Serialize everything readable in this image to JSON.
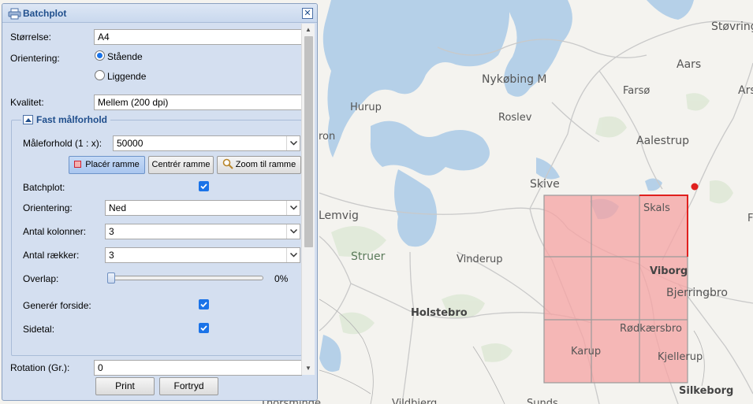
{
  "dialog": {
    "title": "Batchplot",
    "close_label": "✕"
  },
  "form": {
    "size_label": "Størrelse:",
    "size_value": "A4",
    "orientation_label": "Orientering:",
    "orientation_options": [
      "Stående",
      "Liggende"
    ],
    "orientation_selected": "Stående",
    "quality_label": "Kvalitet:",
    "quality_value": "Mellem (200 dpi)",
    "rotation_label": "Rotation (Gr.):",
    "rotation_value": "0"
  },
  "fixed_scale": {
    "legend": "Fast målforhold",
    "scale_label": "Måleforhold (1 : x):",
    "scale_value": "50000",
    "place_frame_label": "Placér ramme",
    "center_frame_label": "Centrér ramme",
    "zoom_frame_label": "Zoom til ramme",
    "batchplot_label": "Batchplot:",
    "batchplot_checked": true,
    "orientation_label": "Orientering:",
    "orientation_value": "Ned",
    "columns_label": "Antal kolonner:",
    "columns_value": "3",
    "rows_label": "Antal rækker:",
    "rows_value": "3",
    "overlap_label": "Overlap:",
    "overlap_value": "0%",
    "overlap_fraction": 0,
    "cover_label": "Generér forside:",
    "cover_checked": true,
    "page_numbers_label": "Sidetal:",
    "page_numbers_checked": true
  },
  "actions": {
    "print_label": "Print",
    "cancel_label": "Fortryd"
  },
  "map": {
    "places": [
      "Støvring",
      "Aars",
      "Ars",
      "Farsø",
      "Nykøbing M",
      "Hurup",
      "Roslev",
      "Aalestrup",
      "Skive",
      "Skals",
      "Lemvig",
      "Struer",
      "Vinderup",
      "Viborg",
      "Bjerringbro",
      "Holstebro",
      "Rødkærsbro",
      "Karup",
      "Kjellerup",
      "Silkeborg",
      "Vildbjerg",
      "Sunds",
      "Thorsminde",
      "ron",
      "F"
    ],
    "colors": {
      "water": "#b5d0e8",
      "land": "#f4f3ef",
      "grid_fill": "#f6a3a3",
      "grid_line": "#9a9a9a",
      "grid_border_active": "#e0201e"
    }
  }
}
